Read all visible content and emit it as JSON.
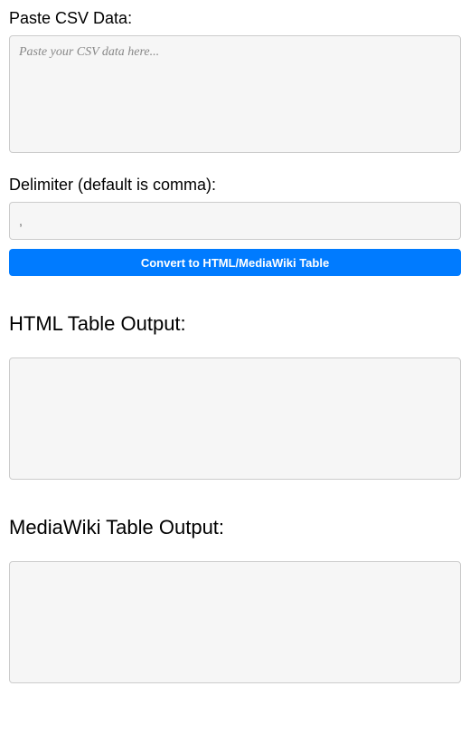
{
  "csv_section": {
    "label": "Paste CSV Data:",
    "placeholder": "Paste your CSV data here..."
  },
  "delimiter_section": {
    "label": "Delimiter (default is comma):",
    "value": ","
  },
  "convert_button": {
    "label": "Convert to HTML/MediaWiki Table"
  },
  "html_output": {
    "heading": "HTML Table Output:"
  },
  "mediawiki_output": {
    "heading": "MediaWiki Table Output:"
  }
}
